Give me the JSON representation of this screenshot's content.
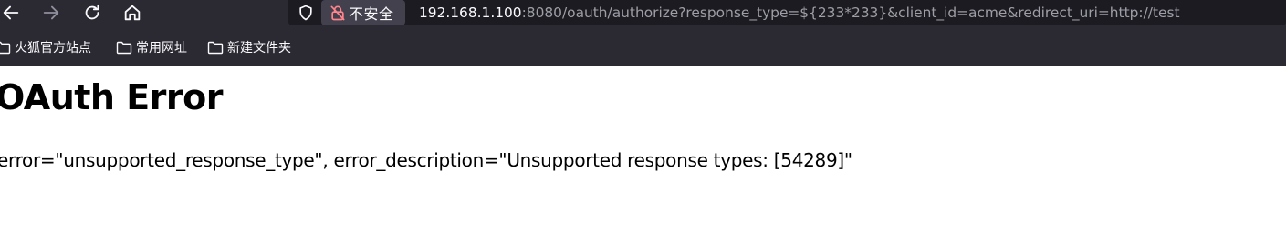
{
  "toolbar": {
    "security_label": "不安全",
    "url_host": "192.168.1.100",
    "url_rest": ":8080/oauth/authorize?response_type=${233*233}&client_id=acme&redirect_uri=http://test"
  },
  "bookmarks": [
    {
      "label": "火狐官方站点"
    },
    {
      "label": "常用网址"
    },
    {
      "label": "新建文件夹"
    }
  ],
  "page": {
    "title": "OAuth Error",
    "error_text": "error=\"unsupported_response_type\", error_description=\"Unsupported response types: [54289]\""
  },
  "colors": {
    "toolbar_bg": "#2b2a33",
    "urlbar_bg": "#1c1b22",
    "insecure_lock": "#ff848b"
  }
}
